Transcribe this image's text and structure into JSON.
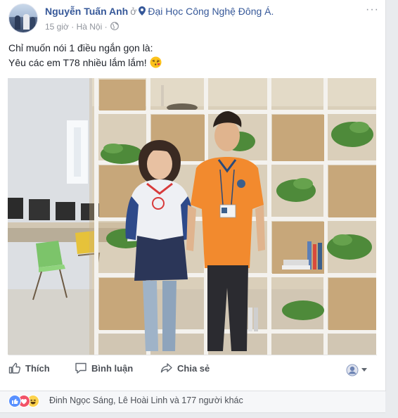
{
  "post": {
    "author": "Nguyễn Tuấn Anh",
    "at": "ở",
    "location": "Đại Học Công Nghệ Đông Á.",
    "time": "15 giờ",
    "separator": "·",
    "city": "Hà Nội",
    "more_menu": "···",
    "text_line1": "Chỉ muốn nói 1 điều ngắn gọn là:",
    "text_line2": "Yêu các em T78 nhiều lắm lắm!"
  },
  "actions": {
    "like": "Thích",
    "comment": "Bình luận",
    "share": "Chia sẻ"
  },
  "reactions": {
    "icons": [
      "like",
      "love",
      "haha"
    ],
    "summary": "Đinh Ngọc Sáng, Lê Hoài Linh và 177 người khác"
  },
  "colors": {
    "link": "#365899",
    "like_blue": "#5890ff",
    "love_red": "#f25268",
    "haha_yellow": "#fcd24d",
    "muted": "#90949c",
    "action_text": "#4b4f56"
  }
}
